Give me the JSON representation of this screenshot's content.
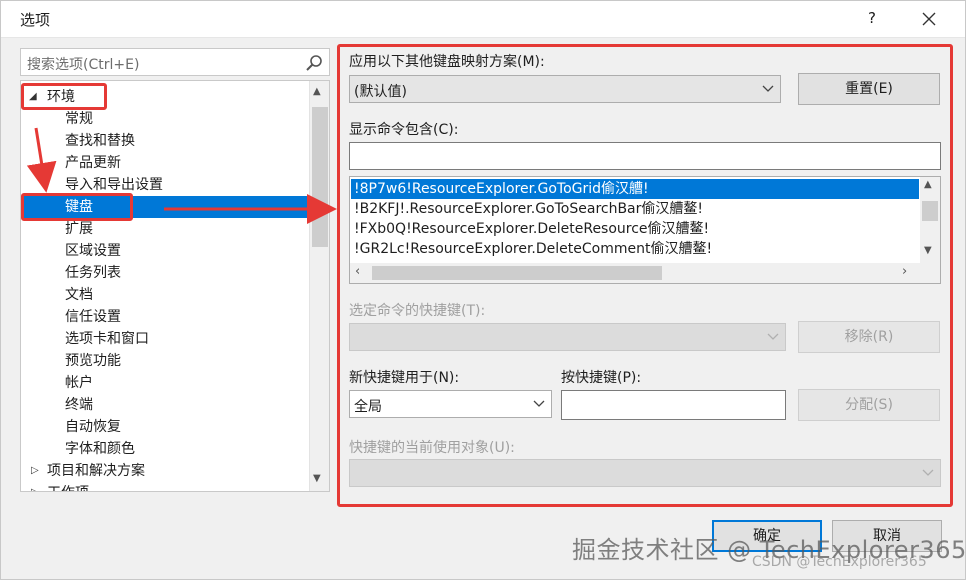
{
  "window": {
    "title": "选项",
    "help_label": "?"
  },
  "search": {
    "placeholder": "搜索选项(Ctrl+E)"
  },
  "tree": {
    "items": [
      {
        "label": "环境",
        "expanded": true
      },
      {
        "label": "常规"
      },
      {
        "label": "查找和替换"
      },
      {
        "label": "产品更新"
      },
      {
        "label": "导入和导出设置"
      },
      {
        "label": "键盘",
        "selected": true
      },
      {
        "label": "扩展"
      },
      {
        "label": "区域设置"
      },
      {
        "label": "任务列表"
      },
      {
        "label": "文档"
      },
      {
        "label": "信任设置"
      },
      {
        "label": "选项卡和窗口"
      },
      {
        "label": "预览功能"
      },
      {
        "label": "帐户"
      },
      {
        "label": "终端"
      },
      {
        "label": "自动恢复"
      },
      {
        "label": "字体和颜色"
      },
      {
        "label": "项目和解决方案",
        "expanded": false
      },
      {
        "label": "工作项"
      }
    ]
  },
  "keyboard": {
    "mapping_label": "应用以下其他键盘映射方案(M):",
    "mapping_value": "(默认值)",
    "reset_label": "重置(E)",
    "show_commands_label": "显示命令包含(C):",
    "show_commands_value": "",
    "commands": [
      "!8P7w6!ResourceExplorer.GoToGrid偷汉艚!",
      "!B2KFJ!.ResourceExplorer.GoToSearchBar偷汉艚鳌!",
      "!FXb0Q!ResourceExplorer.DeleteResource偷汉艚鳌!",
      "!GR2Lc!ResourceExplorer.DeleteComment偷汉艚鳌!"
    ],
    "shortcut_for_selected_label": "选定命令的快捷键(T):",
    "remove_label": "移除(R)",
    "new_shortcut_in_label": "新快捷键用于(N):",
    "new_shortcut_in_value": "全局",
    "press_shortcut_label": "按快捷键(P):",
    "press_shortcut_value": "",
    "assign_label": "分配(S)",
    "currently_used_by_label": "快捷键的当前使用对象(U):"
  },
  "footer": {
    "ok_label": "确定",
    "cancel_label": "取消"
  },
  "watermark": {
    "main": "掘金技术社区 @ TechExplorer365",
    "sub": "CSDN @TechExplorer365"
  },
  "colors": {
    "accent": "#0078d7",
    "annotation": "#e53935"
  }
}
